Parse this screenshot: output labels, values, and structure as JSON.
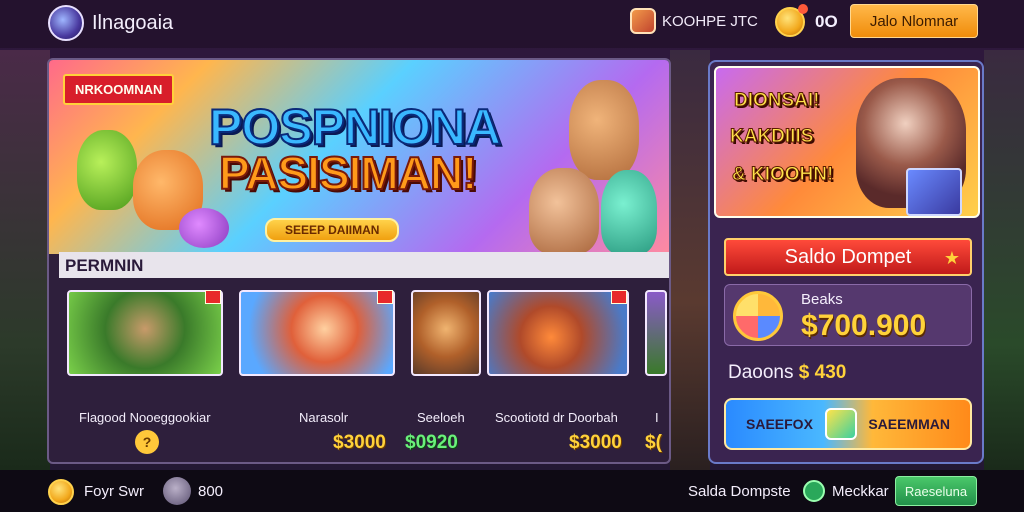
{
  "header": {
    "app_title": "Ilnagoaia",
    "user_name": "KOOHPE JTC",
    "coin_count": "0O",
    "top_button": "Jalo Nlomnar"
  },
  "banner": {
    "tag": "NRKOOMNAN",
    "title_line1": "POSPNIONA",
    "title_line2": "PASISIMAN!",
    "subtitle": "SEEEP DAIIMAN"
  },
  "section": {
    "label": "PERMNIN"
  },
  "cards": [
    {
      "name": "Flagood Nooeggookiar",
      "price": "",
      "has_help": true
    },
    {
      "name": "Narasolr",
      "price": "$3000"
    },
    {
      "name": "Seeloeh",
      "price": "$0920",
      "price_color": "green"
    },
    {
      "name": "Scootiotd dr Doorbah",
      "price": "$3000"
    },
    {
      "name": "I",
      "price": "$("
    }
  ],
  "side_panel": {
    "promo_lines": [
      "DIONSAI!",
      "KAKDIIIS",
      "& KIOOHN!"
    ],
    "balance_title": "Saldo Dompet",
    "balance_label": "Beaks",
    "balance_amount": "$700.900",
    "deposit_label": "Daoons",
    "deposit_amount": "$ 430",
    "action_left": "SAEEFOX",
    "action_right": "SAEEMMAN"
  },
  "footer": {
    "user": "Foyr Swr",
    "count": "800",
    "saldo": "Salda Dompste",
    "member": "Meckkar",
    "button": "Raeseluna"
  }
}
